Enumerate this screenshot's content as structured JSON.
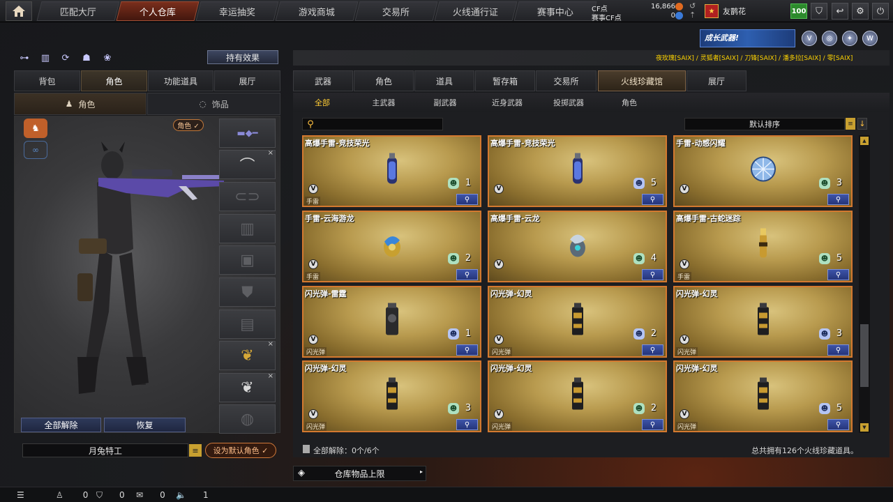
{
  "nav": {
    "tabs": [
      "匹配大厅",
      "个人仓库",
      "幸运抽奖",
      "游戏商城",
      "交易所",
      "火线通行证",
      "赛事中心"
    ],
    "active_tab": "个人仓库"
  },
  "currency": {
    "cf_label": "CF点",
    "cf_value": "16,866",
    "event_label": "赛事CF点",
    "event_value": "0"
  },
  "user": {
    "nickname": "友鹊花",
    "level": "100"
  },
  "banner": {
    "growth_text": "成长武器!"
  },
  "ticker_text": "夜玫瑰[SAIX] / 灵狐者[SAIX] / 刀锋[SAIX] / 潘多拉[SAIX] / 零[SAIX]",
  "left": {
    "holdings_button": "持有效果",
    "tabs": [
      "背包",
      "角色",
      "功能道具",
      "展厅"
    ],
    "active_tab": "角色",
    "subtabs": [
      "角色",
      "饰品"
    ],
    "active_subtab": "角色",
    "role_tag": "角色 ✓",
    "unequip_all": "全部解除",
    "restore": "恢复",
    "character_name": "月兔特工",
    "set_default": "设为默认角色 ✓"
  },
  "right": {
    "tabs": [
      "武器",
      "角色",
      "道具",
      "暂存箱",
      "交易所",
      "火线珍藏馆",
      "展厅"
    ],
    "active_tab": "火线珍藏馆",
    "subtabs": [
      "全部",
      "主武器",
      "副武器",
      "近身武器",
      "投掷武器",
      "角色"
    ],
    "active_subtab": "全部",
    "sort_label": "默认排序",
    "items": [
      {
        "name": "高爆手雷-竞技荣光",
        "category": "手雷",
        "qty": "1",
        "qty_color": "green",
        "art": "grenade-blue"
      },
      {
        "name": "高爆手雷-竞技荣光",
        "category": "",
        "qty": "5",
        "qty_color": "blue",
        "art": "grenade-blue"
      },
      {
        "name": "手雷-动感闪耀",
        "category": "",
        "qty": "3",
        "qty_color": "green",
        "art": "disco-ball"
      },
      {
        "name": "手雷-云海游龙",
        "category": "手雷",
        "qty": "2",
        "qty_color": "green",
        "art": "dragon-gold"
      },
      {
        "name": "高爆手雷-云龙",
        "category": "",
        "qty": "4",
        "qty_color": "green",
        "art": "dragon-silver"
      },
      {
        "name": "高爆手雷-古蛇迷踪",
        "category": "手雷",
        "qty": "5",
        "qty_color": "green",
        "art": "snake-gold"
      },
      {
        "name": "闪光弹-雷霆",
        "category": "闪光弹",
        "qty": "1",
        "qty_color": "blue",
        "art": "flash-black"
      },
      {
        "name": "闪光弹-幻灵",
        "category": "闪光弹",
        "qty": "2",
        "qty_color": "blue",
        "art": "flash-gold"
      },
      {
        "name": "闪光弹-幻灵",
        "category": "闪光弹",
        "qty": "3",
        "qty_color": "blue",
        "art": "flash-gold"
      },
      {
        "name": "闪光弹-幻灵",
        "category": "闪光弹",
        "qty": "3",
        "qty_color": "green",
        "art": "flash-gold"
      },
      {
        "name": "闪光弹-幻灵",
        "category": "闪光弹",
        "qty": "2",
        "qty_color": "green",
        "art": "flash-gold"
      },
      {
        "name": "闪光弹-幻灵",
        "category": "闪光弹",
        "qty": "5",
        "qty_color": "blue",
        "art": "flash-gold"
      }
    ],
    "unequip_summary": "全部解除：0个/6个",
    "total_summary": "总共拥有126个火线珍藏道具。",
    "storage_button": "仓库物品上限"
  },
  "statusbar": {
    "friends": "0",
    "shield": "0",
    "chat": "0",
    "volume": "1"
  },
  "colors": {
    "accent": "#d4792f",
    "active_nav": "#7a2e1c",
    "gold": "#ffcc33"
  }
}
